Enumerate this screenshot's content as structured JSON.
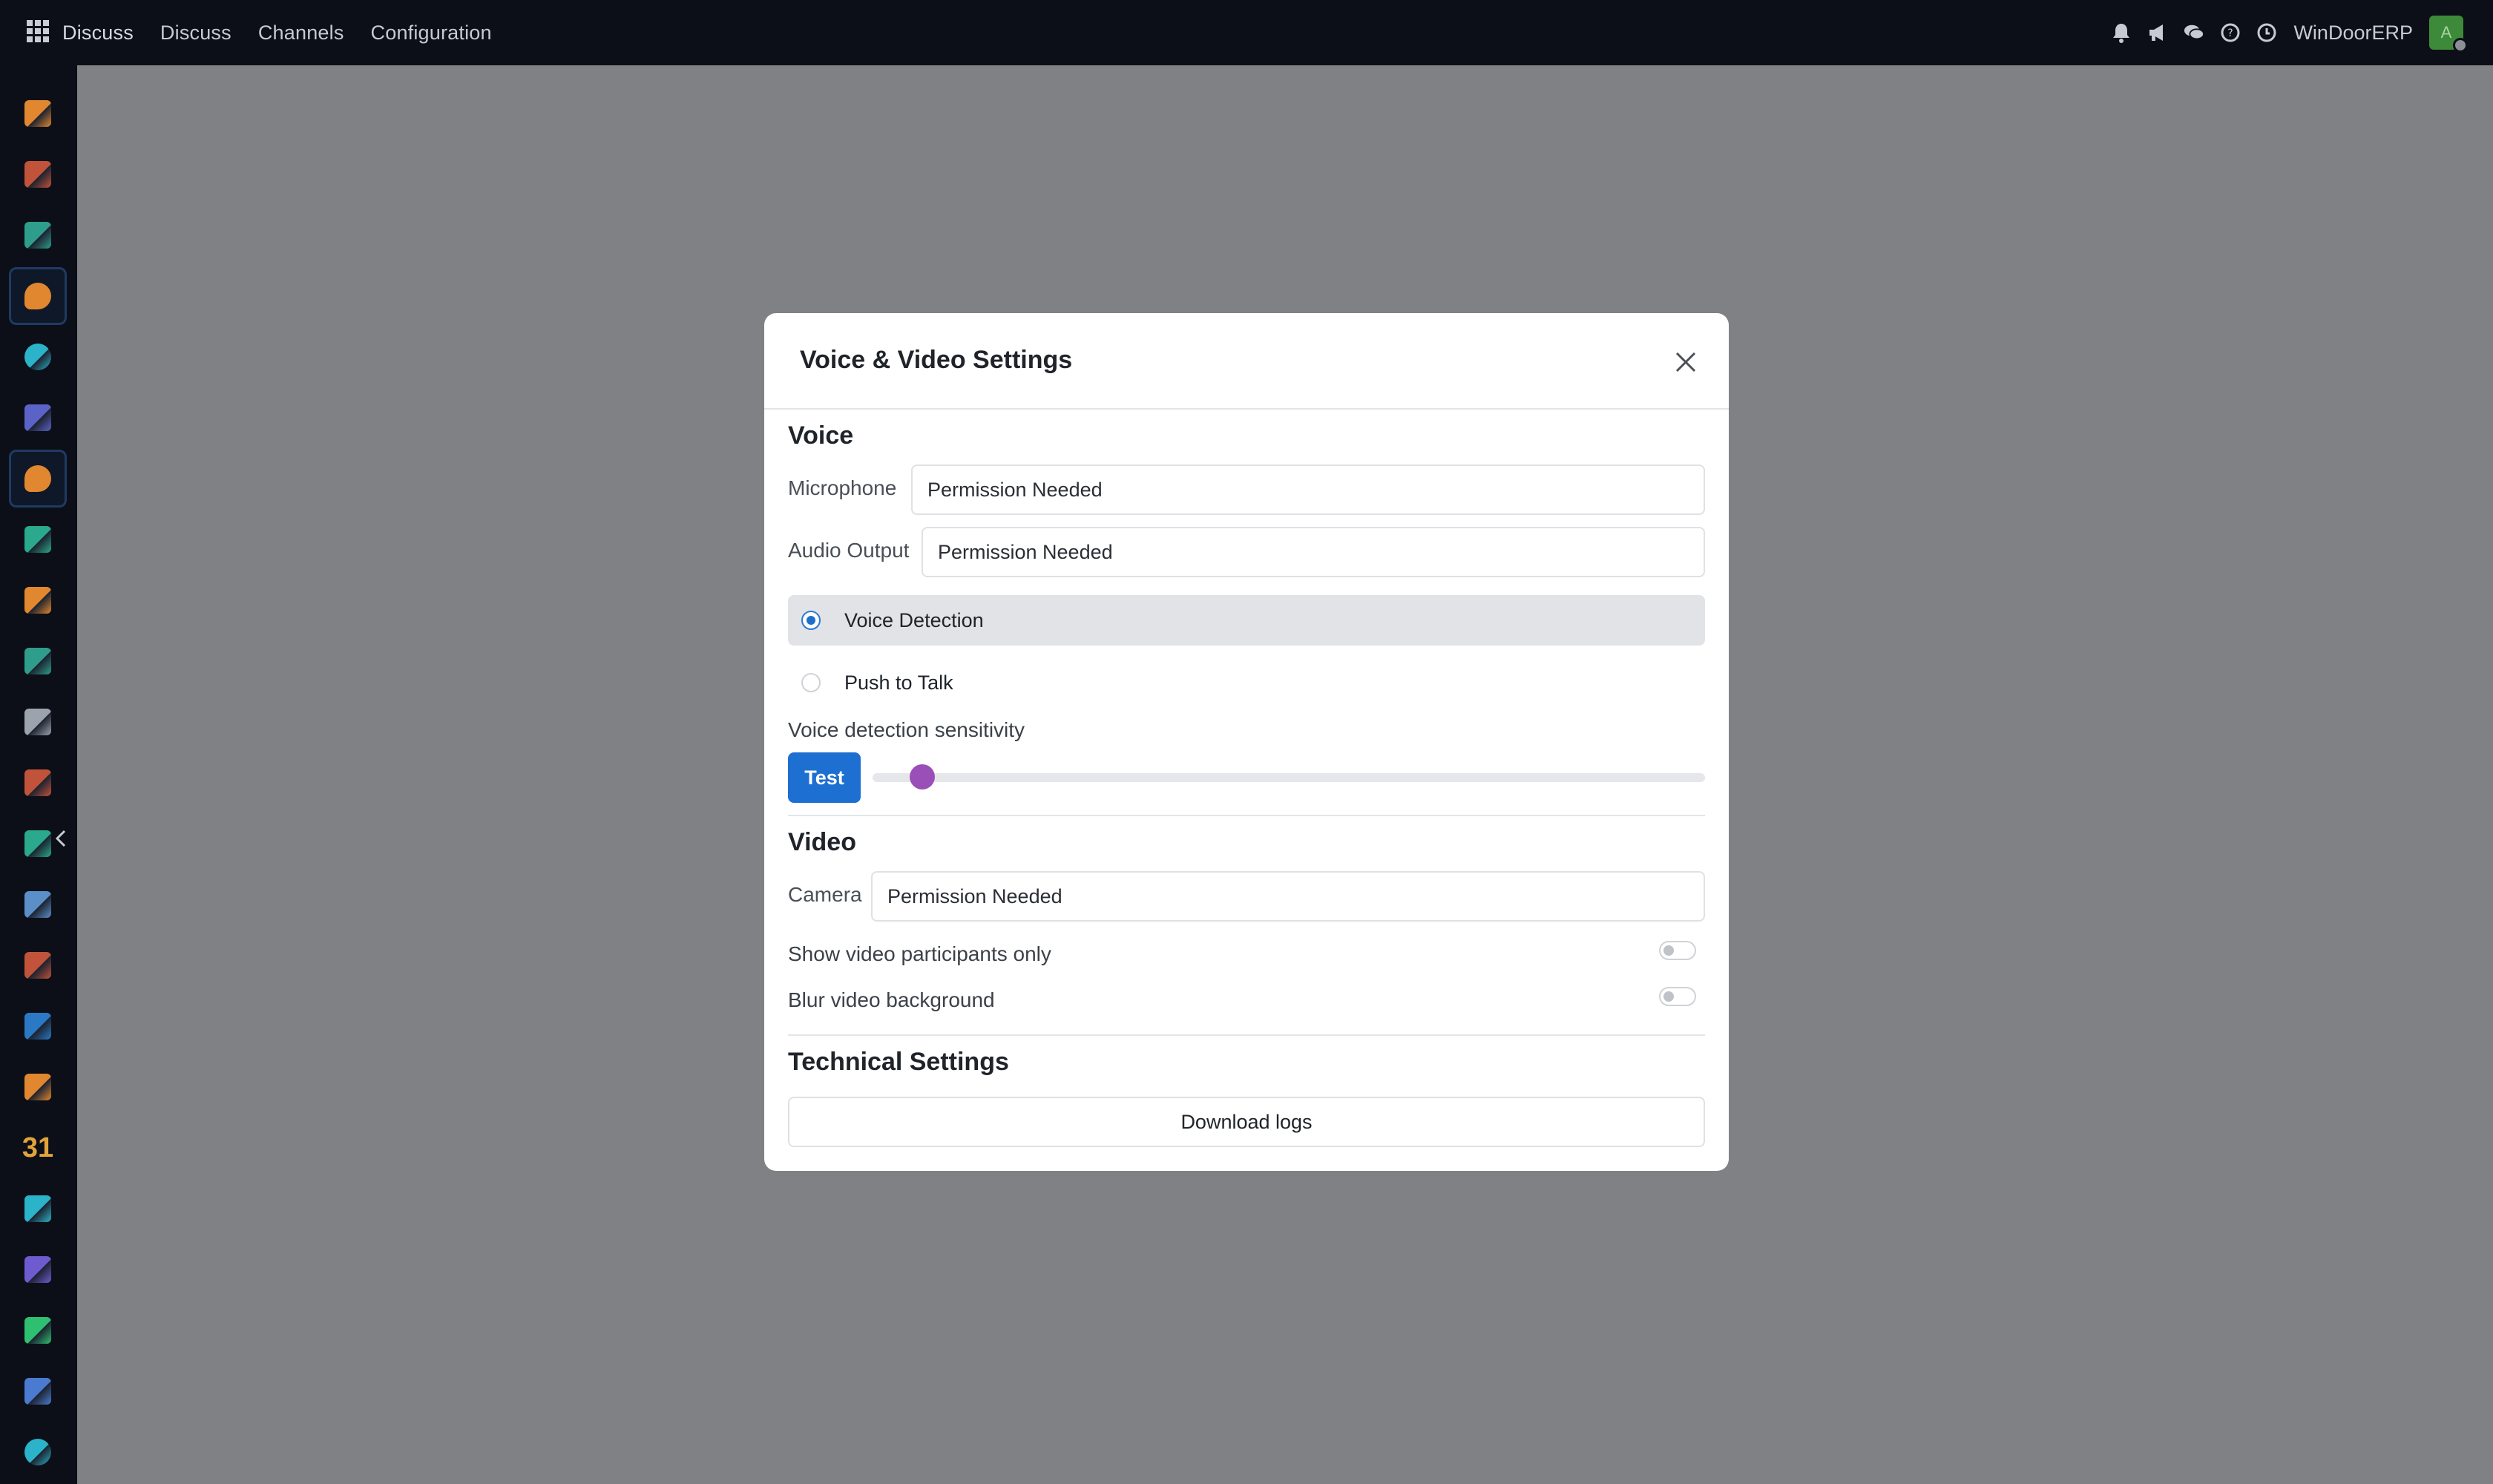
{
  "topbar": {
    "nav": [
      "Discuss",
      "Discuss",
      "Channels",
      "Configuration"
    ],
    "company": "WinDoorERP",
    "avatar_initial": "A",
    "icons": [
      "bell-icon",
      "megaphone-icon",
      "chat-icon",
      "help-icon",
      "clock-icon"
    ]
  },
  "sidebar": {
    "apps": [
      {
        "icon": "chart-app-icon",
        "color": "#e0872f"
      },
      {
        "icon": "puzzle-app-icon",
        "color": "#c0533a"
      },
      {
        "icon": "contacts-app-icon",
        "color": "#2e9d8c"
      },
      {
        "icon": "discuss-app-icon",
        "color": "#e0872f",
        "active": true
      },
      {
        "icon": "sphere-app-icon",
        "color": "#2bb3c9"
      },
      {
        "icon": "mail-app-icon",
        "color": "#5b63c8"
      },
      {
        "icon": "discuss-app-icon-2",
        "color": "#e0872f",
        "active": true
      },
      {
        "icon": "check-app-icon",
        "color": "#2aa98c"
      },
      {
        "icon": "chart-app-icon-2",
        "color": "#e0872f"
      },
      {
        "icon": "contacts-app-icon-2",
        "color": "#2e9d8c"
      },
      {
        "icon": "box-app-icon",
        "color": "#9ca3ad"
      },
      {
        "icon": "puzzle-app-icon-2",
        "color": "#c0533a"
      },
      {
        "icon": "tasks-app-icon",
        "color": "#2aa98c"
      },
      {
        "icon": "book-app-icon",
        "color": "#5b8fc8"
      },
      {
        "icon": "package-app-icon",
        "color": "#c0533a"
      },
      {
        "icon": "document-app-icon",
        "color": "#2b79c4"
      },
      {
        "icon": "people-app-icon",
        "color": "#e0872f"
      },
      {
        "icon": "calendar-app-icon",
        "color": "#e0a43a",
        "text": "31"
      },
      {
        "icon": "sign-app-icon",
        "color": "#2bb3c9"
      },
      {
        "icon": "dashboard-app-icon",
        "color": "#6f5bd0"
      },
      {
        "icon": "whatsapp-app-icon",
        "color": "#2fbf71"
      },
      {
        "icon": "clock-app-icon",
        "color": "#4a7bd0"
      },
      {
        "icon": "sphere-app-icon-2",
        "color": "#2bb3c9"
      }
    ]
  },
  "modal": {
    "title": "Voice & Video Settings",
    "voice": {
      "title": "Voice",
      "microphone_label": "Microphone",
      "microphone_value": "Permission Needed",
      "audio_output_label": "Audio Output",
      "audio_output_value": "Permission Needed",
      "mode_options": [
        {
          "label": "Voice Detection",
          "selected": true
        },
        {
          "label": "Push to Talk",
          "selected": false
        }
      ],
      "sensitivity_label": "Voice detection sensitivity",
      "test_label": "Test",
      "sensitivity_fraction": 0.06
    },
    "video": {
      "title": "Video",
      "camera_label": "Camera",
      "camera_value": "Permission Needed",
      "show_participants_label": "Show video participants only",
      "show_participants_on": false,
      "blur_label": "Blur video background",
      "blur_on": false
    },
    "technical": {
      "title": "Technical Settings",
      "download_label": "Download logs"
    }
  },
  "colors": {
    "accent": "#1e6fd2",
    "slider_thumb": "#9a4fb8",
    "overlay": "#808184",
    "topbar": "#0c0f17"
  }
}
